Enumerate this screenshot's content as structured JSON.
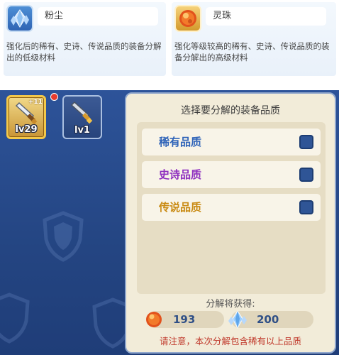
{
  "materials": {
    "dust": {
      "name": "粉尘",
      "icon": "crystal-icon",
      "description": "强化后的稀有、史诗、传说品质的装备分解出的低级材料"
    },
    "orb": {
      "name": "灵珠",
      "icon": "orb-icon",
      "description": "强化等级较高的稀有、史诗、传说品质的装备分解出的高级材料"
    }
  },
  "inventory": {
    "items": [
      {
        "level": "lv29",
        "plus": "+11",
        "selected": true,
        "has_red_dot": true,
        "icon": "sword-icon"
      },
      {
        "level": "lv1",
        "selected": false,
        "icon": "sword-icon"
      }
    ]
  },
  "dialog": {
    "title": "选择要分解的装备品质",
    "qualities": [
      {
        "label": "稀有品质",
        "color": "#2e63b8",
        "checked": false
      },
      {
        "label": "史诗品质",
        "color": "#8e2fbf",
        "checked": false
      },
      {
        "label": "传说品质",
        "color": "#c98a12",
        "checked": false
      }
    ],
    "gain_title": "分解将获得:",
    "gains": {
      "orb": "193",
      "dust": "200"
    },
    "notice": "请注意，本次分解包含稀有以上品质"
  },
  "colors": {
    "panel_bg": "#2a4d90",
    "dialog_bg": "#f2ecd9",
    "checkbox": "#2f5596",
    "notice": "#c0392b"
  }
}
